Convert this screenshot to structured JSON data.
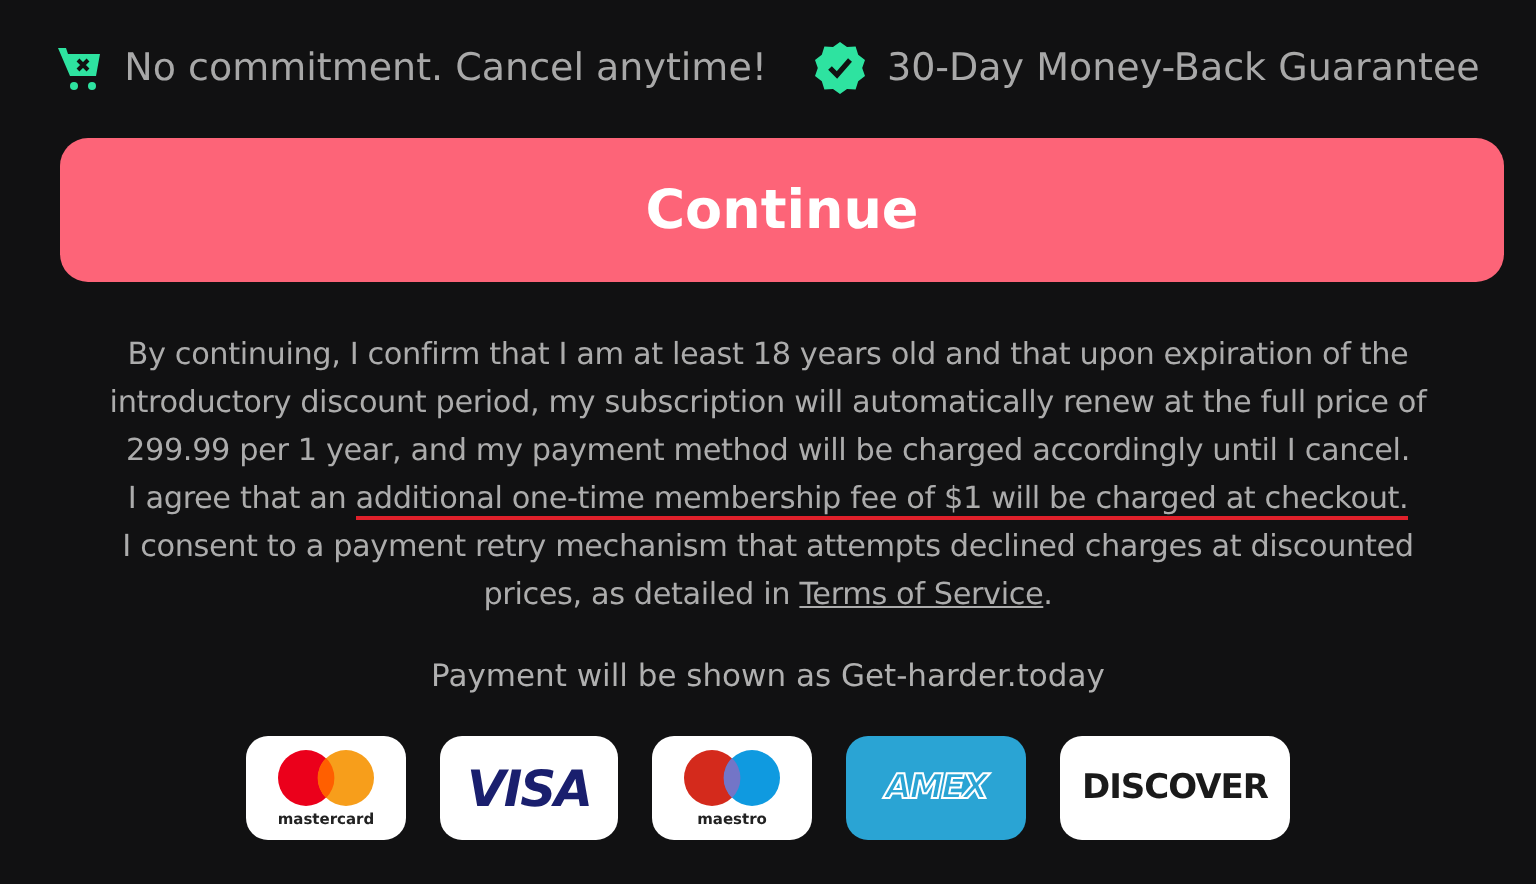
{
  "benefits": [
    {
      "kind": "cart",
      "text": "No commitment. Cancel anytime!"
    },
    {
      "kind": "badge",
      "text": "30-Day Money-Back Guarantee"
    }
  ],
  "continue_button": {
    "label": "Continue"
  },
  "disclaimer": {
    "lines": [
      [
        {
          "kind": "plain",
          "text": "By continuing, I confirm that I am at least 18 years old and that upon expiration of the"
        }
      ],
      [
        {
          "kind": "plain",
          "text": "introductory discount period, my subscription will automatically renew at the full price of"
        }
      ],
      [
        {
          "kind": "plain",
          "text": "299.99 per 1 year, and my payment method will be charged accordingly until I cancel."
        }
      ],
      [
        {
          "kind": "plain",
          "text": "I agree that an "
        },
        {
          "kind": "underlined",
          "text": "additional one-time membership fee of $1 will be charged at checkout."
        }
      ],
      [
        {
          "kind": "plain",
          "text": "I consent to a payment retry mechanism that attempts declined charges at discounted"
        }
      ],
      [
        {
          "kind": "plain",
          "text": "prices, as detailed in "
        },
        {
          "kind": "link",
          "text": "Terms of Service"
        },
        {
          "kind": "plain",
          "text": "."
        }
      ]
    ]
  },
  "payment_note": "Payment will be shown as Get-harder.today",
  "cards": [
    {
      "kind": "mastercard",
      "text": "mastercard"
    },
    {
      "kind": "visa",
      "text": "VISA"
    },
    {
      "kind": "maestro",
      "text": "maestro"
    },
    {
      "kind": "amex",
      "text": "AMEX"
    },
    {
      "kind": "discover",
      "text": "DISCOVER"
    }
  ]
}
